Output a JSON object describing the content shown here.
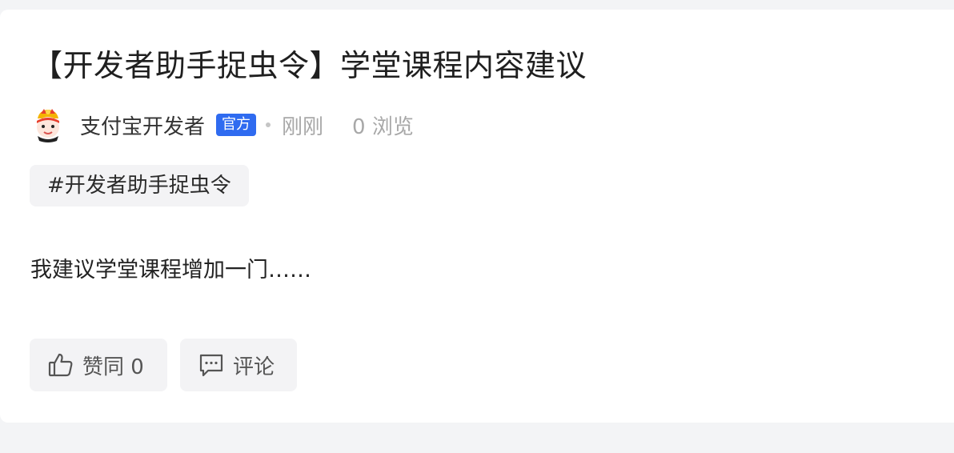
{
  "post": {
    "title": "【开发者助手捉虫令】学堂课程内容建议",
    "author": "支付宝开发者",
    "author_badge": "官方",
    "time": "刚刚",
    "views": "0 浏览",
    "tag": "#开发者助手捉虫令",
    "content": "我建议学堂课程增加一门……"
  },
  "actions": {
    "like_label": "赞同 0",
    "comment_label": "评论"
  },
  "colors": {
    "badge_bg": "#2f6bf0",
    "page_bg": "#f3f4f6",
    "card_bg": "#ffffff",
    "button_bg": "#f3f3f5"
  },
  "icons": {
    "avatar": "avatar-lion-dance-icon",
    "like": "thumbs-up-icon",
    "comment": "comment-bubble-icon"
  }
}
